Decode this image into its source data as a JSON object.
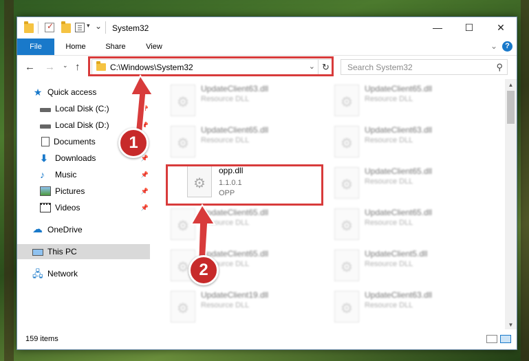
{
  "window": {
    "title": "System32",
    "controls": {
      "minimize": "—",
      "maximize": "☐",
      "close": "✕"
    }
  },
  "ribbon": {
    "tabs": [
      "File",
      "Home",
      "Share",
      "View"
    ],
    "help": "?"
  },
  "address": {
    "path": "C:\\Windows\\System32"
  },
  "search": {
    "placeholder": "Search System32"
  },
  "nav": {
    "items": [
      {
        "label": "Quick access",
        "icon": "star-icon"
      },
      {
        "label": "Local Disk (C:)",
        "icon": "disk-icon",
        "pinned": true
      },
      {
        "label": "Local Disk (D:)",
        "icon": "disk-icon",
        "pinned": true
      },
      {
        "label": "Documents",
        "icon": "documents-icon",
        "pinned": true
      },
      {
        "label": "Downloads",
        "icon": "downloads-icon",
        "pinned": true
      },
      {
        "label": "Music",
        "icon": "music-icon",
        "pinned": true
      },
      {
        "label": "Pictures",
        "icon": "pictures-icon",
        "pinned": true
      },
      {
        "label": "Videos",
        "icon": "videos-icon",
        "pinned": true
      },
      {
        "label": "OneDrive",
        "icon": "onedrive-icon"
      },
      {
        "label": "This PC",
        "icon": "this-pc-icon",
        "selected": true
      },
      {
        "label": "Network",
        "icon": "network-icon"
      }
    ]
  },
  "files": [
    {
      "name": "UpdateClient63.dll",
      "type": "Resource DLL",
      "blurred": true
    },
    {
      "name": "UpdateClient65.dll",
      "type": "Resource DLL",
      "blurred": true
    },
    {
      "name": "UpdateClient65.dll",
      "type": "Resource DLL",
      "blurred": true
    },
    {
      "name": "UpdateClient63.dll",
      "type": "Resource DLL",
      "blurred": true
    },
    {
      "name": "opp.dll",
      "version": "1.1.0.1",
      "type": "OPP",
      "blurred": false
    },
    {
      "name": "UpdateClient65.dll",
      "type": "Resource DLL",
      "blurred": true
    },
    {
      "name": "UpdateClient65.dll",
      "type": "Resource DLL",
      "blurred": true
    },
    {
      "name": "UpdateClient65.dll",
      "type": "Resource DLL",
      "blurred": true
    },
    {
      "name": "UpdateClient65.dll",
      "type": "Resource DLL",
      "blurred": true
    },
    {
      "name": "UpdateClient5.dll",
      "type": "Resource DLL",
      "blurred": true
    },
    {
      "name": "UpdateClient19.dll",
      "type": "Resource DLL",
      "blurred": true
    },
    {
      "name": "UpdateClient63.dll",
      "type": "Resource DLL",
      "blurred": true
    }
  ],
  "status": {
    "item_count": "159 items"
  },
  "annotations": {
    "step1": "1",
    "step2": "2",
    "color": "#d83b3b"
  }
}
